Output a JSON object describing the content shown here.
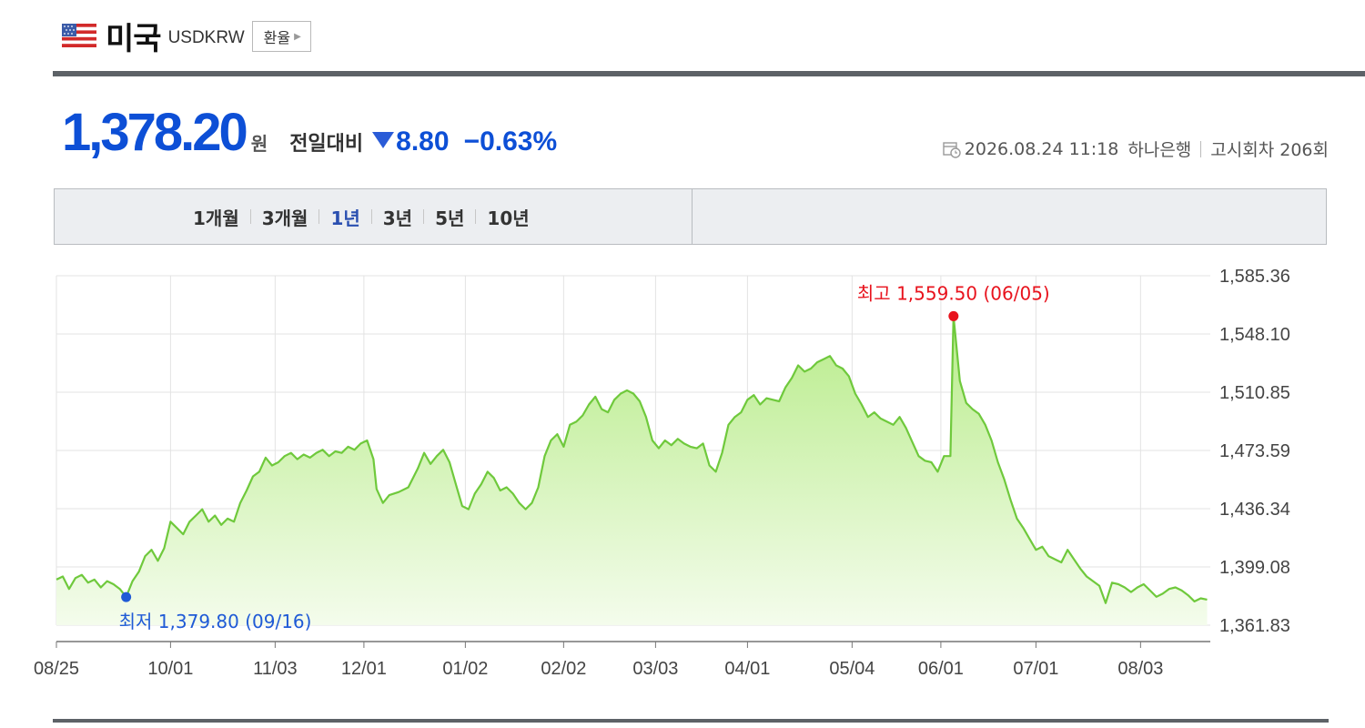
{
  "header": {
    "country": "미국",
    "code": "USDKRW",
    "fx_button": "환율",
    "icons": {
      "flag": "us-flag-icon",
      "arrow": "chevron-right-icon"
    }
  },
  "price": {
    "value": "1,378.20",
    "unit": "원",
    "compare_label": "전일대비",
    "change": "8.80",
    "change_pct": "−0.63%",
    "direction": "down",
    "color": "#0d4fd6"
  },
  "meta": {
    "datetime": "2026.08.24 11:18",
    "bank": "하나은행",
    "notice": "고시회차 206회"
  },
  "tabs": [
    {
      "label": "1개월",
      "active": false
    },
    {
      "label": "3개월",
      "active": false
    },
    {
      "label": "1년",
      "active": true
    },
    {
      "label": "3년",
      "active": false
    },
    {
      "label": "5년",
      "active": false
    },
    {
      "label": "10년",
      "active": false
    }
  ],
  "chart_data": {
    "type": "area",
    "y_ticks": [
      "1,585.36",
      "1,548.10",
      "1,510.85",
      "1,473.59",
      "1,436.34",
      "1,399.08",
      "1,361.83"
    ],
    "ylim": [
      1361.83,
      1585.36
    ],
    "x_ticks": [
      "08/25",
      "10/01",
      "11/03",
      "12/01",
      "01/02",
      "02/02",
      "03/03",
      "04/01",
      "05/04",
      "06/01",
      "07/01",
      "08/03"
    ],
    "x_tick_pos": [
      0,
      36,
      69,
      97,
      129,
      160,
      189,
      218,
      251,
      279,
      309,
      342
    ],
    "x_end": 364,
    "grid": true,
    "line_color": "#6fc93c",
    "fill_color": "#b8ec8a",
    "high": {
      "label": "최고 1,559.50 (06/05)",
      "x": 283,
      "value": 1559.5,
      "color": "#e8131d"
    },
    "low": {
      "label": "최저 1,379.80 (09/16)",
      "x": 22,
      "value": 1379.8,
      "color": "#1f5ad6"
    },
    "series": [
      [
        0,
        1391
      ],
      [
        2,
        1393
      ],
      [
        4,
        1385
      ],
      [
        6,
        1392
      ],
      [
        8,
        1394
      ],
      [
        10,
        1389
      ],
      [
        12,
        1391
      ],
      [
        14,
        1386
      ],
      [
        16,
        1390
      ],
      [
        18,
        1388
      ],
      [
        20,
        1385
      ],
      [
        22,
        1379.8
      ],
      [
        24,
        1390
      ],
      [
        26,
        1396
      ],
      [
        28,
        1406
      ],
      [
        30,
        1410
      ],
      [
        32,
        1403
      ],
      [
        34,
        1411
      ],
      [
        36,
        1428
      ],
      [
        38,
        1424
      ],
      [
        40,
        1420
      ],
      [
        42,
        1428
      ],
      [
        44,
        1432
      ],
      [
        46,
        1436
      ],
      [
        48,
        1428
      ],
      [
        50,
        1432
      ],
      [
        52,
        1426
      ],
      [
        54,
        1430
      ],
      [
        56,
        1428
      ],
      [
        58,
        1440
      ],
      [
        60,
        1448
      ],
      [
        62,
        1457
      ],
      [
        64,
        1460
      ],
      [
        66,
        1469
      ],
      [
        68,
        1464
      ],
      [
        70,
        1466
      ],
      [
        72,
        1470
      ],
      [
        74,
        1472
      ],
      [
        76,
        1468
      ],
      [
        78,
        1471
      ],
      [
        80,
        1469
      ],
      [
        82,
        1472
      ],
      [
        84,
        1474
      ],
      [
        86,
        1470
      ],
      [
        88,
        1473
      ],
      [
        90,
        1472
      ],
      [
        92,
        1476
      ],
      [
        94,
        1474
      ],
      [
        96,
        1478
      ],
      [
        98,
        1480
      ],
      [
        100,
        1468
      ],
      [
        101,
        1449
      ],
      [
        103,
        1440
      ],
      [
        105,
        1445
      ],
      [
        108,
        1447
      ],
      [
        111,
        1450
      ],
      [
        114,
        1462
      ],
      [
        116,
        1472
      ],
      [
        118,
        1465
      ],
      [
        120,
        1470
      ],
      [
        122,
        1474
      ],
      [
        124,
        1466
      ],
      [
        126,
        1452
      ],
      [
        128,
        1438
      ],
      [
        130,
        1436
      ],
      [
        132,
        1446
      ],
      [
        134,
        1452
      ],
      [
        136,
        1460
      ],
      [
        138,
        1456
      ],
      [
        140,
        1448
      ],
      [
        142,
        1450
      ],
      [
        144,
        1446
      ],
      [
        146,
        1440
      ],
      [
        148,
        1436
      ],
      [
        150,
        1440
      ],
      [
        152,
        1450
      ],
      [
        154,
        1470
      ],
      [
        156,
        1480
      ],
      [
        158,
        1484
      ],
      [
        160,
        1476
      ],
      [
        162,
        1490
      ],
      [
        164,
        1492
      ],
      [
        166,
        1496
      ],
      [
        168,
        1503
      ],
      [
        170,
        1508
      ],
      [
        172,
        1500
      ],
      [
        174,
        1498
      ],
      [
        176,
        1506
      ],
      [
        178,
        1510
      ],
      [
        180,
        1512
      ],
      [
        182,
        1510
      ],
      [
        184,
        1505
      ],
      [
        186,
        1495
      ],
      [
        188,
        1480
      ],
      [
        190,
        1475
      ],
      [
        192,
        1480
      ],
      [
        194,
        1477
      ],
      [
        196,
        1481
      ],
      [
        198,
        1478
      ],
      [
        200,
        1476
      ],
      [
        202,
        1475
      ],
      [
        204,
        1478
      ],
      [
        206,
        1464
      ],
      [
        208,
        1460
      ],
      [
        210,
        1472
      ],
      [
        212,
        1490
      ],
      [
        214,
        1495
      ],
      [
        216,
        1498
      ],
      [
        218,
        1506
      ],
      [
        220,
        1509
      ],
      [
        222,
        1503
      ],
      [
        224,
        1507
      ],
      [
        226,
        1506
      ],
      [
        228,
        1505
      ],
      [
        230,
        1514
      ],
      [
        232,
        1520
      ],
      [
        234,
        1528
      ],
      [
        236,
        1524
      ],
      [
        238,
        1526
      ],
      [
        240,
        1530
      ],
      [
        242,
        1532
      ],
      [
        244,
        1534
      ],
      [
        246,
        1528
      ],
      [
        248,
        1526
      ],
      [
        250,
        1521
      ],
      [
        252,
        1510
      ],
      [
        254,
        1503
      ],
      [
        256,
        1495
      ],
      [
        258,
        1498
      ],
      [
        260,
        1494
      ],
      [
        262,
        1492
      ],
      [
        264,
        1490
      ],
      [
        266,
        1495
      ],
      [
        268,
        1488
      ],
      [
        270,
        1479
      ],
      [
        272,
        1470
      ],
      [
        274,
        1467
      ],
      [
        276,
        1466
      ],
      [
        278,
        1460
      ],
      [
        280,
        1470
      ],
      [
        282,
        1470
      ],
      [
        283,
        1559.5
      ],
      [
        285,
        1518
      ],
      [
        287,
        1504
      ],
      [
        289,
        1500
      ],
      [
        291,
        1497
      ],
      [
        293,
        1490
      ],
      [
        295,
        1480
      ],
      [
        297,
        1466
      ],
      [
        299,
        1455
      ],
      [
        301,
        1442
      ],
      [
        303,
        1430
      ],
      [
        305,
        1424
      ],
      [
        307,
        1417
      ],
      [
        309,
        1410
      ],
      [
        311,
        1412
      ],
      [
        313,
        1406
      ],
      [
        315,
        1404
      ],
      [
        317,
        1402
      ],
      [
        319,
        1410
      ],
      [
        321,
        1404
      ],
      [
        323,
        1398
      ],
      [
        325,
        1393
      ],
      [
        327,
        1390
      ],
      [
        329,
        1387
      ],
      [
        331,
        1376
      ],
      [
        333,
        1389
      ],
      [
        335,
        1388
      ],
      [
        337,
        1386
      ],
      [
        339,
        1383
      ],
      [
        341,
        1386
      ],
      [
        343,
        1388
      ],
      [
        345,
        1384
      ],
      [
        347,
        1380
      ],
      [
        349,
        1382
      ],
      [
        351,
        1385
      ],
      [
        353,
        1386
      ],
      [
        355,
        1384
      ],
      [
        357,
        1381
      ],
      [
        359,
        1377
      ],
      [
        361,
        1379
      ],
      [
        363,
        1378.2
      ]
    ]
  }
}
